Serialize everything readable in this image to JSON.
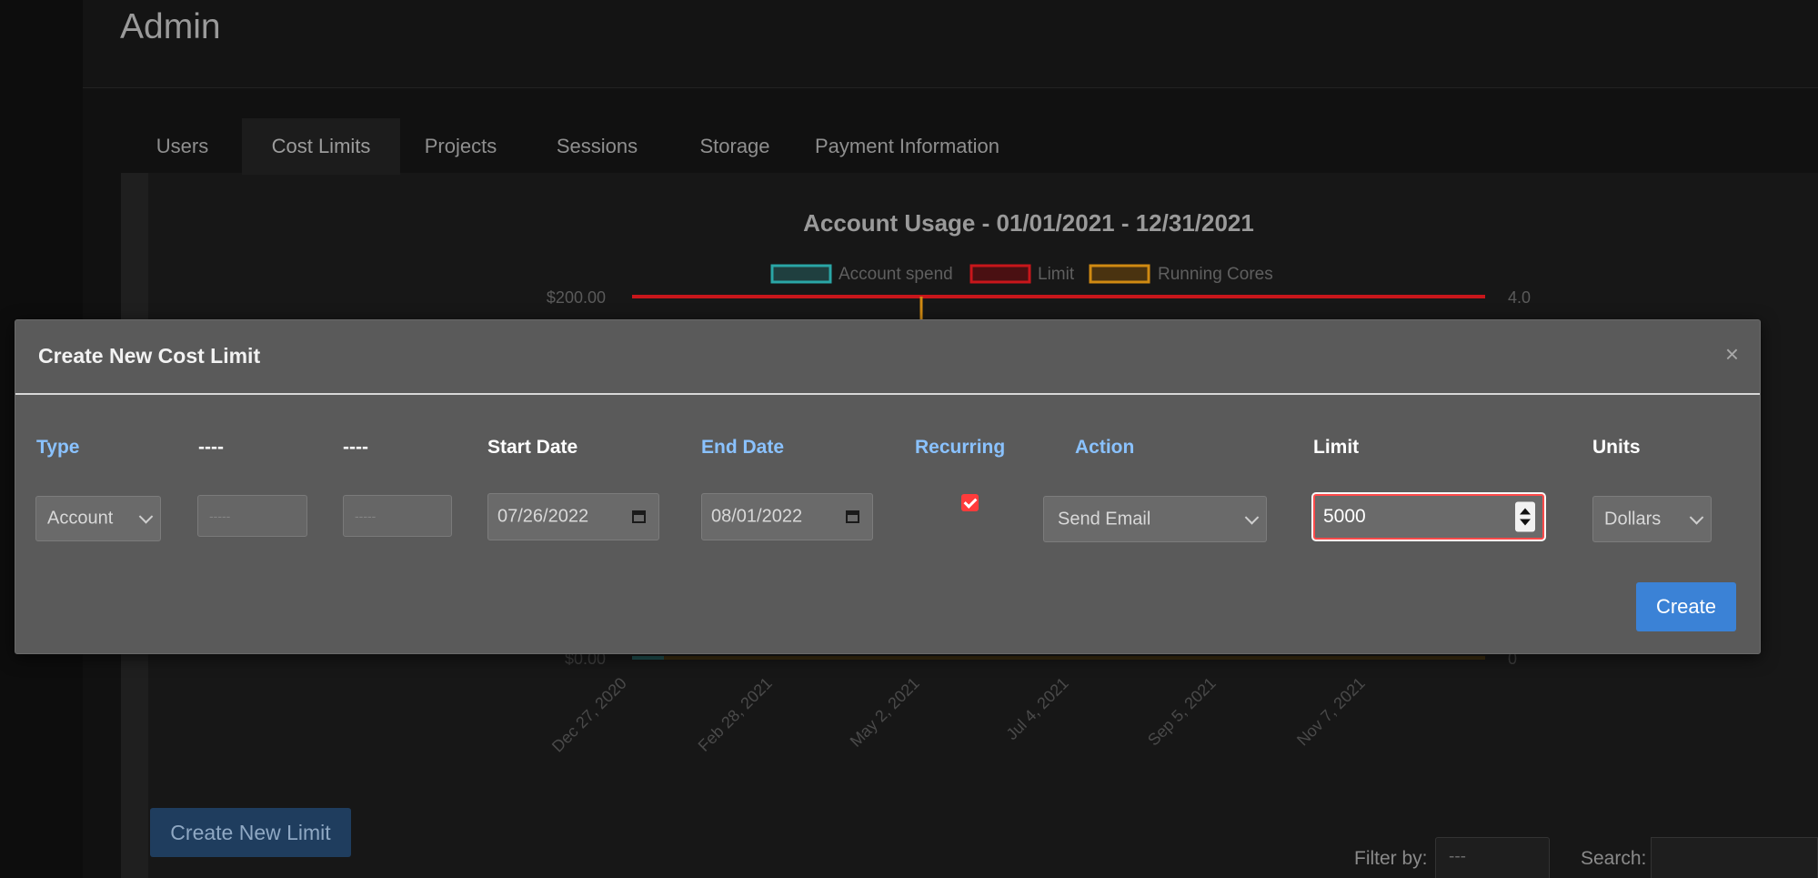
{
  "page": {
    "title": "Admin"
  },
  "tabs": [
    {
      "label": "Users"
    },
    {
      "label": "Cost Limits"
    },
    {
      "label": "Projects"
    },
    {
      "label": "Sessions"
    },
    {
      "label": "Storage"
    },
    {
      "label": "Payment Information"
    }
  ],
  "active_tab": "Cost Limits",
  "chart_data": {
    "type": "line",
    "title": "Account Usage - 01/01/2021 - 12/31/2021",
    "legend": [
      "Account spend",
      "Limit",
      "Running Cores"
    ],
    "legend_placement": "top",
    "series_colors": {
      "Account spend": "#2aa6a6",
      "Limit": "#c8161b",
      "Running Cores": "#d08a12"
    },
    "y_left_ticks": [
      "$200.00",
      "$0.00"
    ],
    "y_right_ticks": [
      "4.0",
      "0"
    ],
    "x_ticks": [
      "Dec 27, 2020",
      "Feb 28, 2021",
      "May 2, 2021",
      "Jul 4, 2021",
      "Sep 5, 2021",
      "Nov 7, 2021"
    ],
    "limit_value": 200,
    "ylim_left": [
      0,
      200
    ],
    "ylim_right": [
      0,
      4
    ]
  },
  "buttons": {
    "create_new_limit": "Create New Limit"
  },
  "filter": {
    "label": "Filter by:",
    "value": "---"
  },
  "search": {
    "label": "Search:",
    "value": ""
  },
  "modal": {
    "title": "Create New Cost Limit",
    "close": "×",
    "columns": {
      "type": "Type",
      "dash1": "----",
      "dash2": "----",
      "start_date": "Start Date",
      "end_date": "End Date",
      "recurring": "Recurring",
      "action": "Action",
      "limit": "Limit",
      "units": "Units"
    },
    "fields": {
      "type_value": "Account",
      "dash1_placeholder": "-----",
      "dash2_placeholder": "-----",
      "start_date": "07/26/2022",
      "end_date": "08/01/2022",
      "recurring_checked": true,
      "action_value": "Send Email",
      "limit_value": "5000",
      "units_value": "Dollars"
    },
    "create_button": "Create"
  }
}
